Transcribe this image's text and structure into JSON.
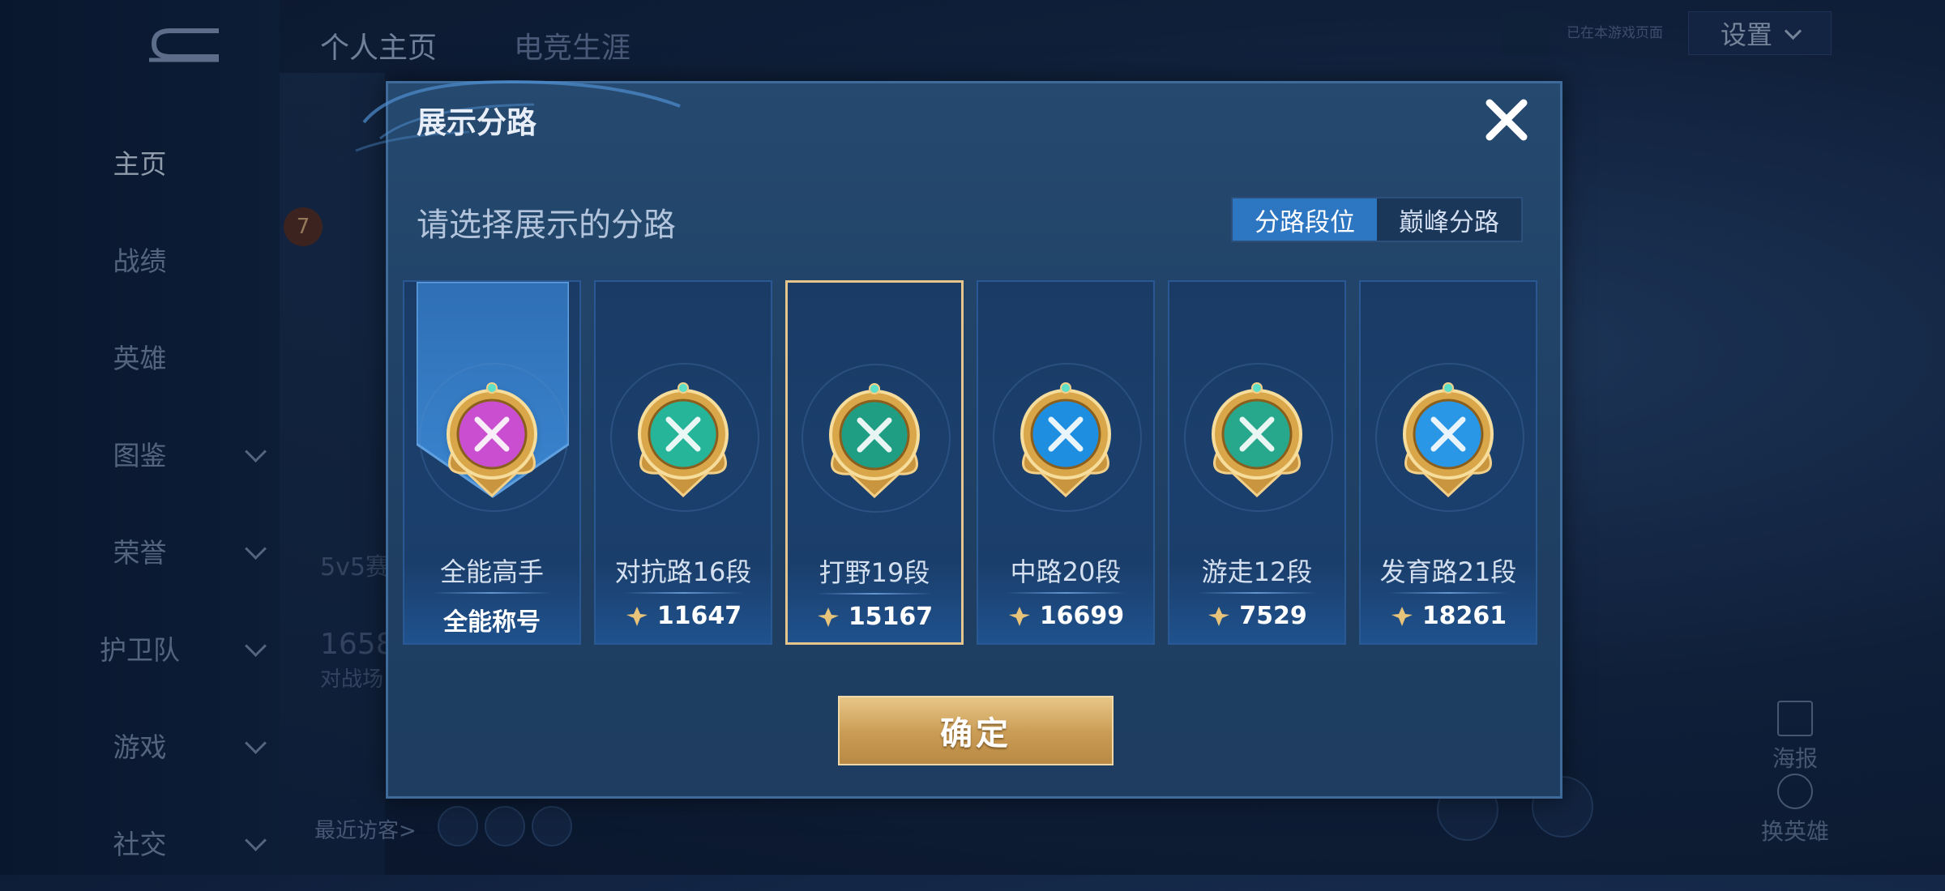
{
  "background": {
    "nav_items": [
      {
        "label": "主页",
        "active": true,
        "has_chevron": false
      },
      {
        "label": "战绩",
        "active": false,
        "has_chevron": false
      },
      {
        "label": "英雄",
        "active": false,
        "has_chevron": false
      },
      {
        "label": "图鉴",
        "active": false,
        "has_chevron": true
      },
      {
        "label": "荣誉",
        "active": false,
        "has_chevron": true
      },
      {
        "label": "护卫队",
        "active": false,
        "has_chevron": true
      },
      {
        "label": "游戏",
        "active": false,
        "has_chevron": true
      },
      {
        "label": "社交",
        "active": false,
        "has_chevron": true
      }
    ],
    "top_tabs": [
      "个人主页",
      "电竞生涯"
    ],
    "notice": "已在本游戏页面",
    "settings_label": "设置",
    "level_badge": "7",
    "mode_label": "5v5赛",
    "stat_number": "1658",
    "stat_label": "对战场",
    "visitors_label": "最近访客>",
    "poster_label": "海报",
    "change_hero_label": "换英雄"
  },
  "dialog": {
    "title": "展示分路",
    "subtitle": "请选择展示的分路",
    "segments": [
      {
        "label": "分路段位",
        "active": true
      },
      {
        "label": "巅峰分路",
        "active": false
      }
    ],
    "cards": [
      {
        "name": "全能高手",
        "value": "全能称号",
        "badge_color": "#c94fd0",
        "selected": false,
        "has_score_icon": false
      },
      {
        "name": "对抗路16段",
        "value": "11647",
        "badge_color": "#27b59a",
        "selected": false,
        "has_score_icon": true
      },
      {
        "name": "打野19段",
        "value": "15167",
        "badge_color": "#1f9e84",
        "selected": true,
        "has_score_icon": true
      },
      {
        "name": "中路20段",
        "value": "16699",
        "badge_color": "#1e8fe0",
        "selected": false,
        "has_score_icon": true
      },
      {
        "name": "游走12段",
        "value": "7529",
        "badge_color": "#27a88c",
        "selected": false,
        "has_score_icon": true
      },
      {
        "name": "发育路21段",
        "value": "18261",
        "badge_color": "#2a96e6",
        "selected": false,
        "has_score_icon": true
      }
    ],
    "confirm_label": "确定"
  }
}
